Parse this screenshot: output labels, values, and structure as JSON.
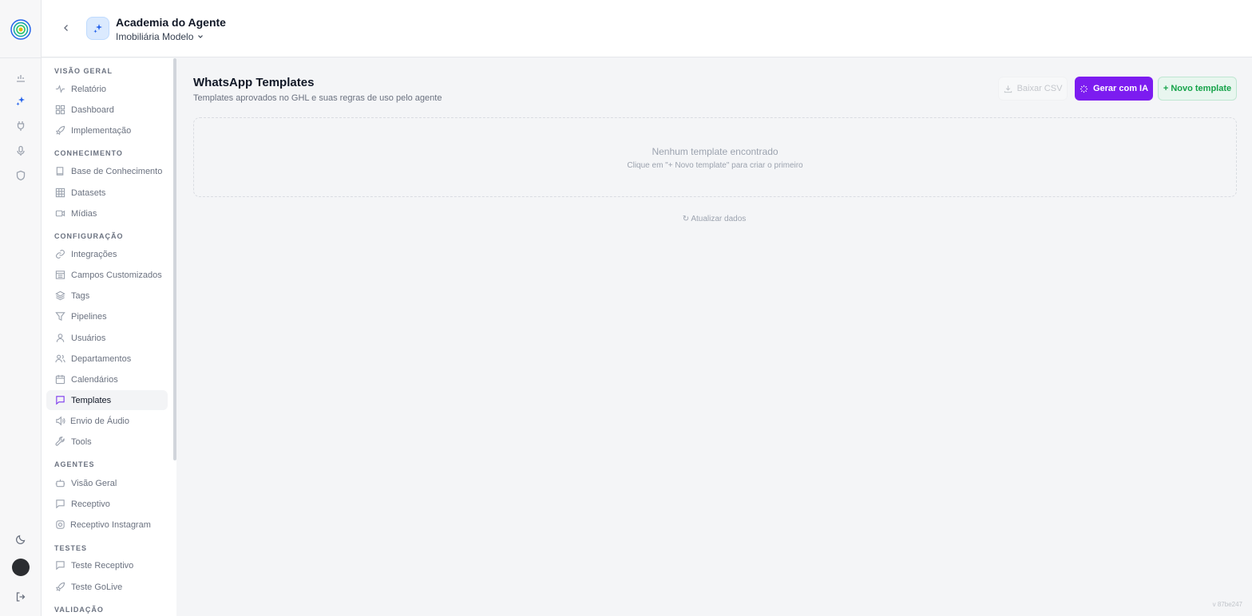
{
  "app": {
    "agent_name": "Academia do Agente",
    "org_name": "Imobiliária Modelo",
    "version": "v 87be247"
  },
  "rail": {
    "icons": [
      "chart-icon",
      "sparkles-icon",
      "plug-icon",
      "mic-icon",
      "shield-icon"
    ],
    "bottom_icons": [
      "moon-icon",
      "avatar",
      "logout-icon"
    ]
  },
  "sidebar": {
    "sections": [
      {
        "title": "VISÃO GERAL",
        "items": [
          {
            "label": "Relatório",
            "icon": "activity-icon"
          },
          {
            "label": "Dashboard",
            "icon": "grid-icon"
          },
          {
            "label": "Implementação",
            "icon": "rocket-icon"
          }
        ]
      },
      {
        "title": "CONHECIMENTO",
        "items": [
          {
            "label": "Base de Conhecimento",
            "icon": "book-icon"
          },
          {
            "label": "Datasets",
            "icon": "table-icon"
          },
          {
            "label": "Mídias",
            "icon": "video-icon"
          }
        ]
      },
      {
        "title": "CONFIGURAÇÃO",
        "items": [
          {
            "label": "Integrações",
            "icon": "link-icon"
          },
          {
            "label": "Campos Customizados",
            "icon": "list-icon"
          },
          {
            "label": "Tags",
            "icon": "layers-icon"
          },
          {
            "label": "Pipelines",
            "icon": "filter-icon"
          },
          {
            "label": "Usuários",
            "icon": "user-icon"
          },
          {
            "label": "Departamentos",
            "icon": "users-icon"
          },
          {
            "label": "Calendários",
            "icon": "calendar-icon"
          },
          {
            "label": "Templates",
            "icon": "message-icon",
            "active": true
          },
          {
            "label": "Envio de Áudio",
            "icon": "speaker-icon"
          },
          {
            "label": "Tools",
            "icon": "wrench-icon"
          }
        ]
      },
      {
        "title": "AGENTES",
        "items": [
          {
            "label": "Visão Geral",
            "icon": "bot-icon"
          },
          {
            "label": "Receptivo",
            "icon": "message-icon"
          },
          {
            "label": "Receptivo Instagram",
            "icon": "instagram-icon"
          }
        ]
      },
      {
        "title": "TESTES",
        "items": [
          {
            "label": "Teste Receptivo",
            "icon": "message-icon"
          },
          {
            "label": "Teste GoLive",
            "icon": "rocket-icon"
          }
        ]
      },
      {
        "title": "VALIDAÇÃO",
        "items": []
      }
    ]
  },
  "main": {
    "title": "WhatsApp Templates",
    "subtitle": "Templates aprovados no GHL e suas regras de uso pelo agente",
    "buttons": {
      "csv": "Baixar CSV",
      "ai": "Gerar com IA",
      "new": "+ Novo template"
    },
    "empty": {
      "title": "Nenhum template encontrado",
      "subtitle": "Clique em \"+ Novo template\" para criar o primeiro"
    },
    "refresh": "↻ Atualizar dados"
  },
  "colors": {
    "accent_purple": "#7c1cf0",
    "accent_green": "#16a34a",
    "background": "#f4f5f7"
  }
}
